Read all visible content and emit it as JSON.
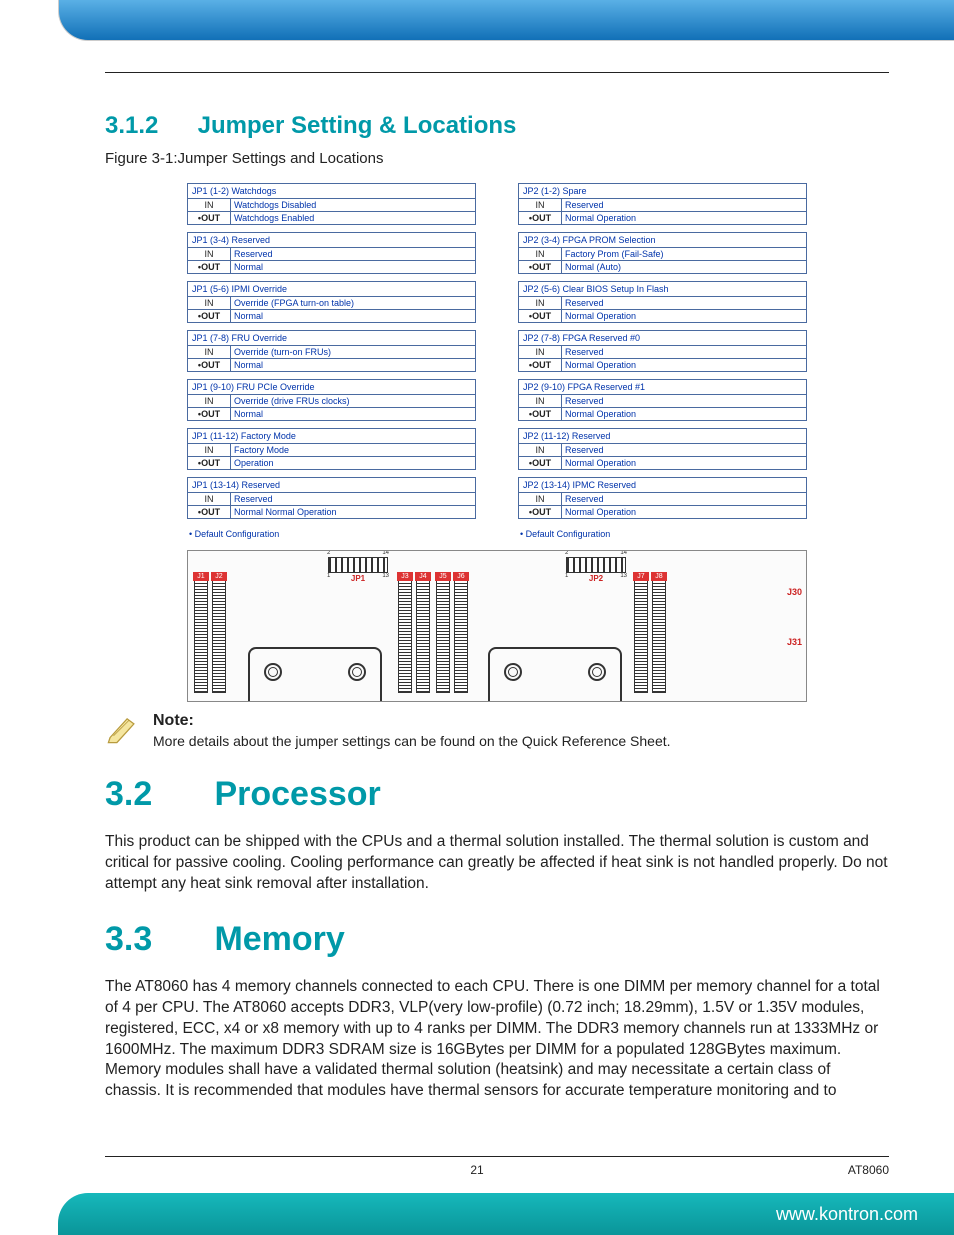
{
  "sections": {
    "s312": {
      "num": "3.1.2",
      "title": "Jumper Setting & Locations",
      "figure_caption": "Figure 3-1:Jumper Settings and Locations"
    },
    "s32": {
      "num": "3.2",
      "title": "Processor",
      "body": "This product can be shipped with the CPUs and a thermal solution installed. The thermal solution is custom and critical for passive cooling. Cooling performance can greatly be affected if heat sink is not handled properly. Do not attempt any heat sink removal after installation."
    },
    "s33": {
      "num": "3.3",
      "title": "Memory",
      "body": "The AT8060 has 4 memory channels connected to each CPU. There is one DIMM per memory channel for a total of 4 per CPU. The AT8060 accepts DDR3, VLP(very low-profile) (0.72 inch; 18.29mm), 1.5V or 1.35V modules, registered, ECC, x4 or x8 memory with up to 4 ranks per DIMM. The DDR3 memory channels run at 1333MHz or 1600MHz. The maximum DDR3 SDRAM size is 16GBytes per DIMM for a populated 128GBytes maximum. Memory modules shall have a validated thermal solution (heatsink) and may necessitate a certain class of chassis. It is recommended that modules have thermal sensors for accurate temperature monitoring and to"
    }
  },
  "jumpers": {
    "jp1": [
      {
        "hdr": "JP1 (1-2) Watchdogs",
        "in": "Watchdogs Disabled",
        "out": "Watchdogs Enabled"
      },
      {
        "hdr": "JP1 (3-4) Reserved",
        "in": "Reserved",
        "out": "Normal"
      },
      {
        "hdr": "JP1 (5-6) IPMI Override",
        "in": "Override (FPGA turn-on table)",
        "out": "Normal"
      },
      {
        "hdr": "JP1 (7-8) FRU Override",
        "in": "Override (turn-on FRUs)",
        "out": "Normal"
      },
      {
        "hdr": "JP1 (9-10) FRU PCIe Override",
        "in": "Override (drive FRUs clocks)",
        "out": "Normal"
      },
      {
        "hdr": "JP1 (11-12) Factory Mode",
        "in": "Factory Mode",
        "out": "Operation"
      },
      {
        "hdr": "JP1 (13-14) Reserved",
        "in": "Reserved",
        "out": "Normal Normal Operation"
      }
    ],
    "jp2": [
      {
        "hdr": "JP2 (1-2) Spare",
        "in": "Reserved",
        "out": "Normal Operation"
      },
      {
        "hdr": "JP2 (3-4) FPGA PROM Selection",
        "in": "Factory Prom (Fail-Safe)",
        "out": "Normal (Auto)"
      },
      {
        "hdr": "JP2 (5-6) Clear BIOS Setup In Flash",
        "in": "Reserved",
        "out": "Normal Operation"
      },
      {
        "hdr": "JP2 (7-8) FPGA Reserved #0",
        "in": "Reserved",
        "out": "Normal Operation"
      },
      {
        "hdr": "JP2 (9-10) FPGA Reserved #1",
        "in": "Reserved",
        "out": "Normal Operation"
      },
      {
        "hdr": "JP2 (11-12) Reserved",
        "in": "Reserved",
        "out": "Normal Operation"
      },
      {
        "hdr": "JP2 (13-14) IPMC Reserved",
        "in": "Reserved",
        "out": "Normal Operation"
      }
    ],
    "default_cfg": "• Default Configuration",
    "in_label": "IN",
    "out_label": "OUT"
  },
  "board": {
    "slots": [
      "J1",
      "J2",
      "J3",
      "J4",
      "J5",
      "J6",
      "J7",
      "J8"
    ],
    "conns": [
      "J30",
      "J31"
    ],
    "jp1": "JP1",
    "jp2": "JP2",
    "pin_low": "2",
    "pin_high": "14",
    "pin_one": "1",
    "pin_thirteen": "13"
  },
  "note": {
    "title": "Note:",
    "body": "More details about the jumper settings can be found on the Quick Reference Sheet."
  },
  "footer": {
    "page": "21",
    "model": "AT8060",
    "url": "www.kontron.com"
  }
}
